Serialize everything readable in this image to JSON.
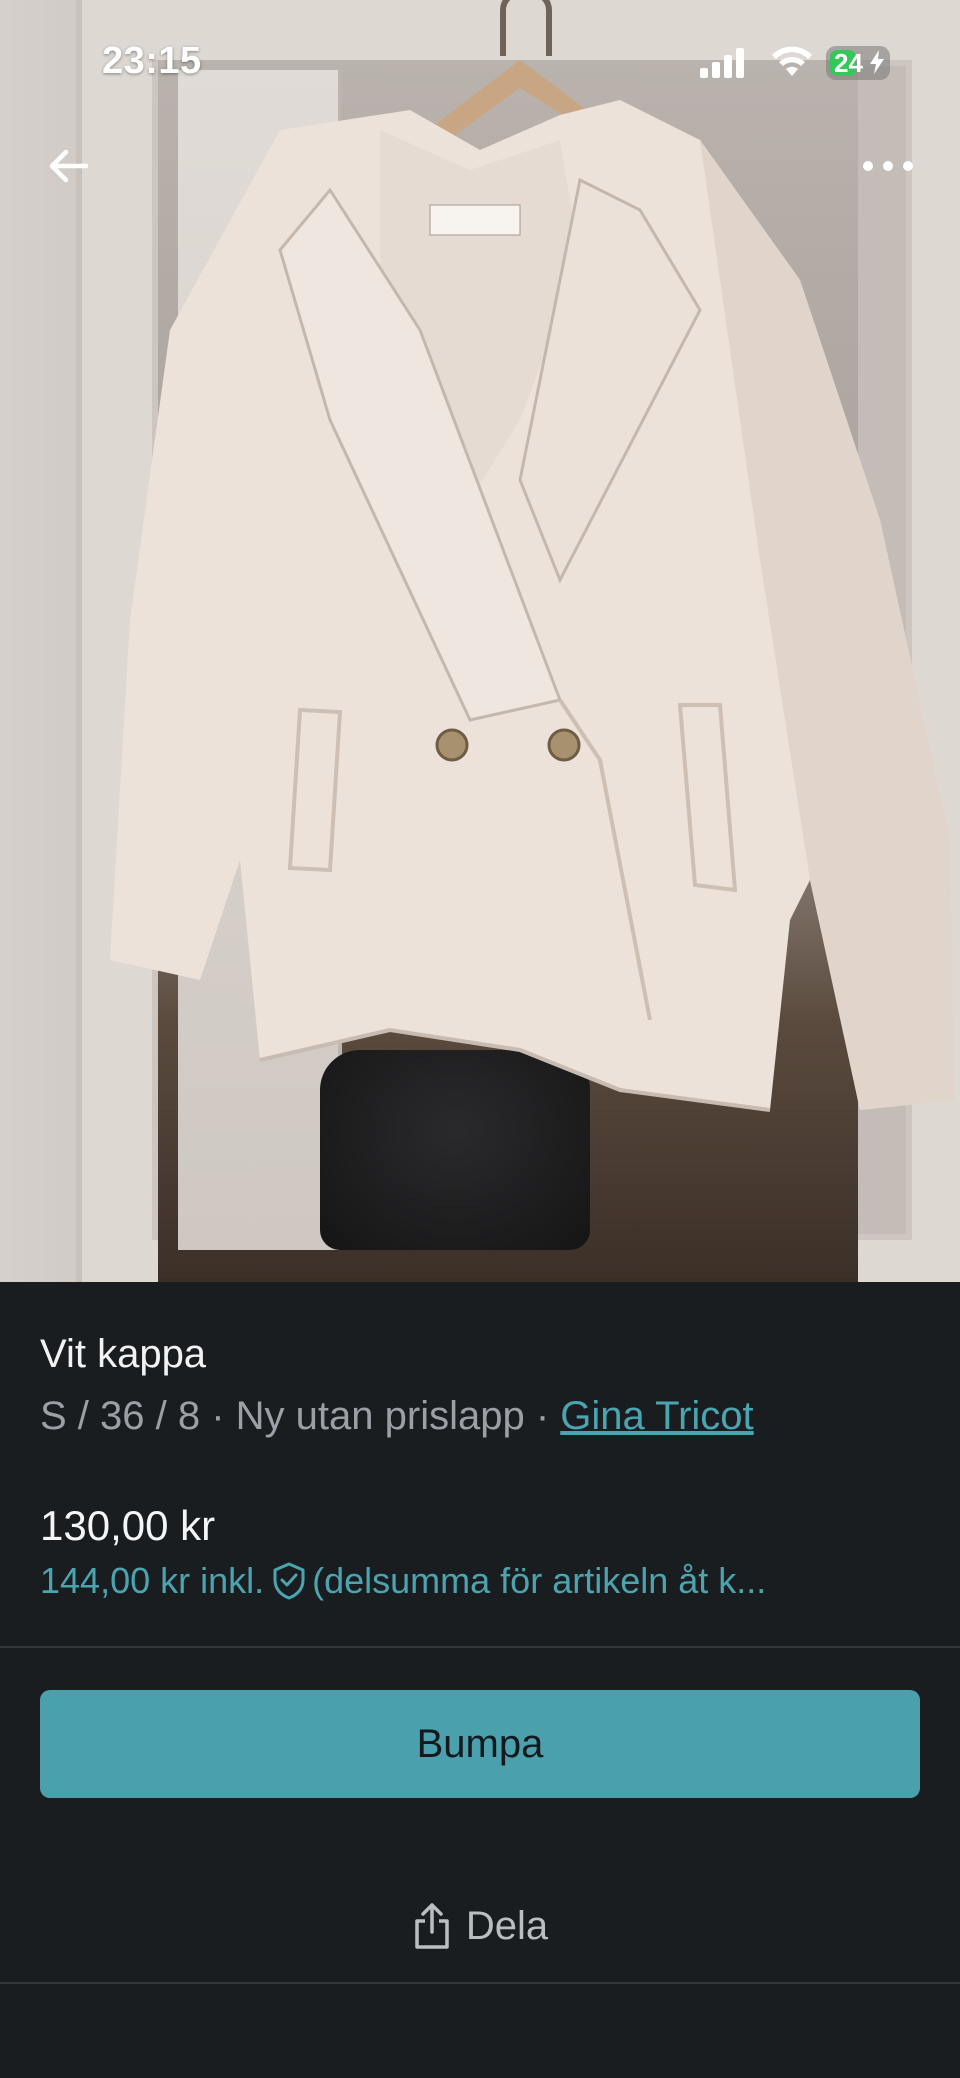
{
  "status_bar": {
    "time": "23:15",
    "battery_level": "24",
    "icons": [
      "signal-icon",
      "wifi-icon",
      "battery-icon",
      "bolt-icon"
    ]
  },
  "nav": {
    "back_icon": "arrow-left-icon",
    "more_icon": "more-horizontal-icon"
  },
  "listing": {
    "title": "Vit kappa",
    "size": "S / 36 / 8",
    "separator": " · ",
    "condition": "Ny utan prislapp",
    "brand": "Gina Tricot",
    "price": "130,00 kr",
    "price_incl": "144,00 kr inkl.",
    "price_incl_note": "(delsumma för artikeln åt k..."
  },
  "actions": {
    "bump_label": "Bumpa",
    "share_label": "Dela",
    "share_icon": "share-icon"
  },
  "colors": {
    "accent": "#4aa1ad",
    "link": "#4aa5b1",
    "background": "#1a1d20",
    "text_primary": "#f1f2f3",
    "text_secondary": "#9aa0a6"
  }
}
